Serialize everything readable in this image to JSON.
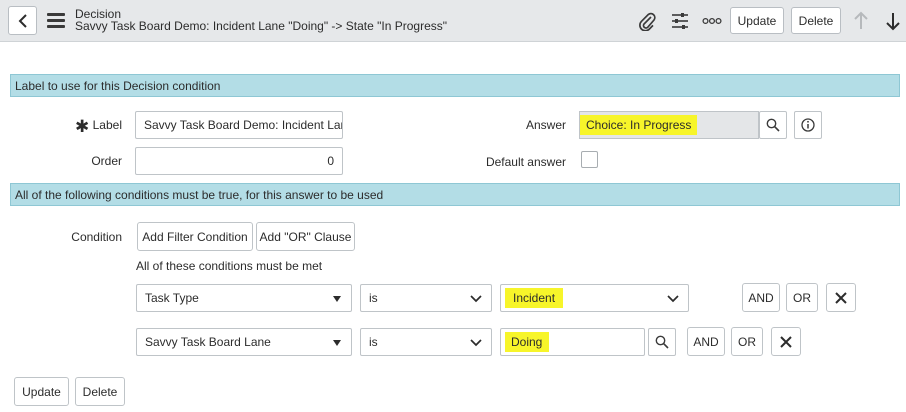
{
  "header": {
    "title": "Decision",
    "subtitle": "Savvy Task Board Demo: Incident Lane \"Doing\" -> State \"In Progress\"",
    "update_label": "Update",
    "delete_label": "Delete"
  },
  "section1": {
    "label": "Label to use for this Decision condition"
  },
  "form": {
    "label_label": "Label",
    "label_value": "Savvy Task Board Demo: Incident Lane",
    "order_label": "Order",
    "order_value": "0",
    "answer_label": "Answer",
    "answer_value": "Choice: In Progress",
    "default_answer_label": "Default answer"
  },
  "section2": {
    "label": "All of the following conditions must be true, for this answer to be used"
  },
  "condition": {
    "label": "Condition",
    "add_filter_label": "Add Filter Condition",
    "add_or_label": "Add \"OR\" Clause",
    "all_met_text": "All of these conditions must be met",
    "rows": [
      {
        "field": "Task Type",
        "operator": "is",
        "value": "Incident",
        "and_label": "AND",
        "or_label": "OR"
      },
      {
        "field": "Savvy Task Board Lane",
        "operator": "is",
        "value": "Doing",
        "and_label": "AND",
        "or_label": "OR"
      }
    ]
  },
  "footer": {
    "update_label": "Update",
    "delete_label": "Delete"
  },
  "colors": {
    "section_bg": "#b3dde6",
    "highlight": "#f7f52a",
    "header_bg": "#e6e8ea"
  }
}
